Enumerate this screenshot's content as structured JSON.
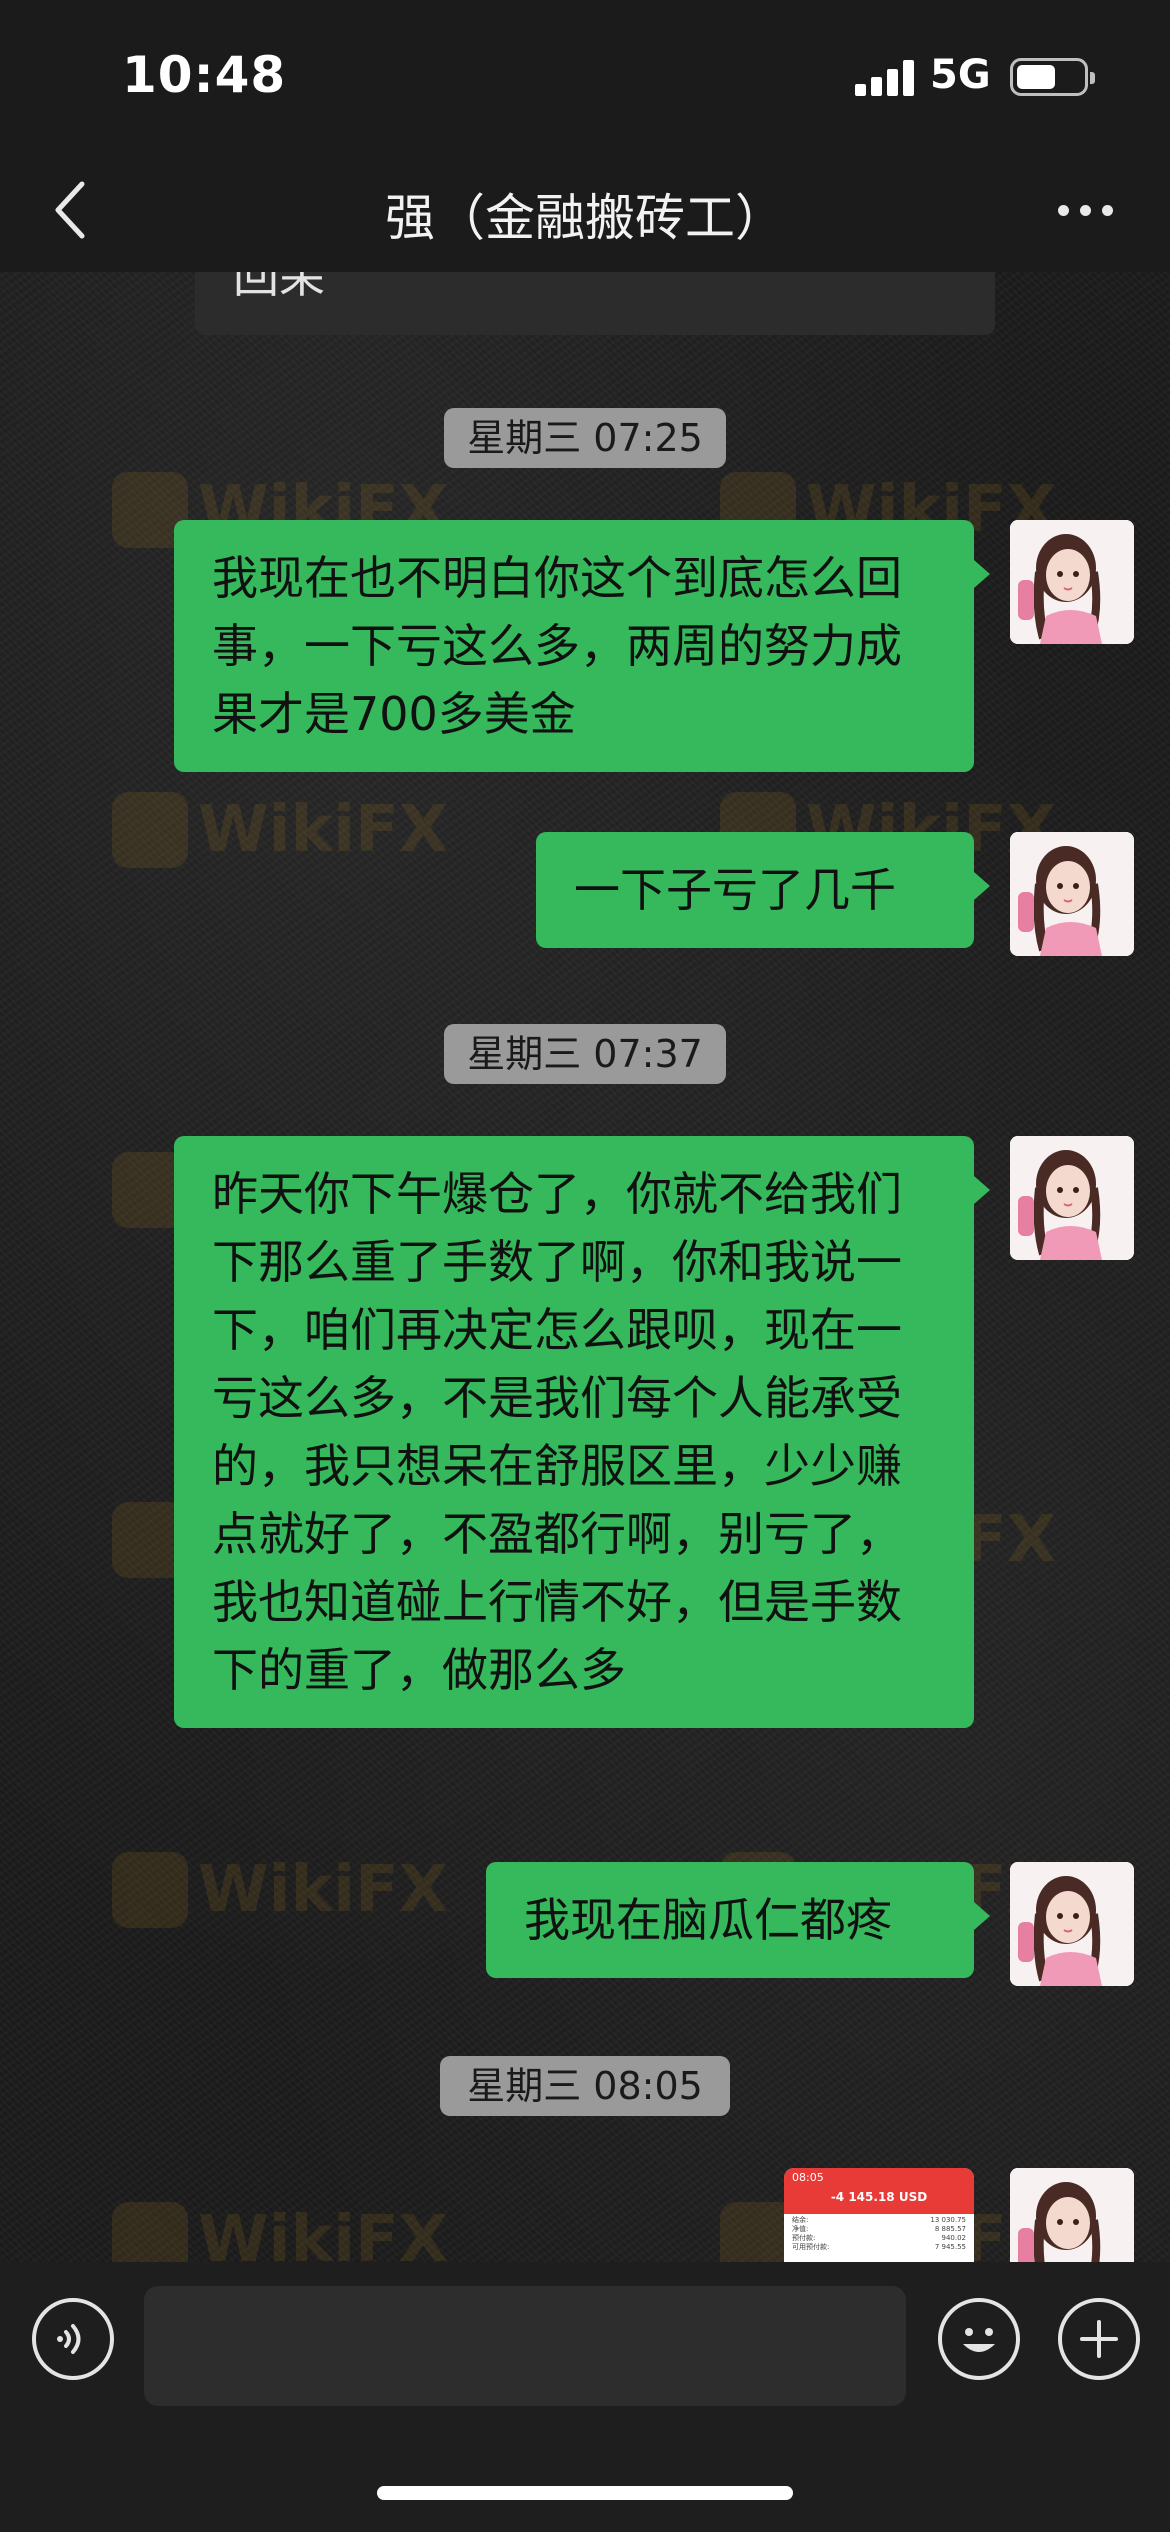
{
  "status_bar": {
    "time": "10:48",
    "network": "5G"
  },
  "header": {
    "title": "强（金融搬砖工）"
  },
  "previous_bubble": {
    "text": "回呆"
  },
  "watermark_text": "WikiFX",
  "messages": [
    {
      "type": "timestamp",
      "text": "星期三 07:25"
    },
    {
      "type": "text",
      "sender": "me",
      "text": "我现在也不明白你这个到底怎么回事，一下亏这么多，两周的努力成果才是700多美金"
    },
    {
      "type": "text",
      "sender": "me",
      "text": "一下子亏了几千"
    },
    {
      "type": "timestamp",
      "text": "星期三 07:37"
    },
    {
      "type": "text",
      "sender": "me",
      "text": "昨天你下午爆仓了，你就不给我们下那么重了手数了啊，你和我说一下，咱们再决定怎么跟呗，现在一亏这么多，不是我们每个人能承受的，我只想呆在舒服区里，少少赚点就好了，不盈都行啊，别亏了，我也知道碰上行情不好，但是手数下的重了，做那么多"
    },
    {
      "type": "text",
      "sender": "me",
      "text": "我现在脑瓜仁都疼"
    },
    {
      "type": "timestamp",
      "text": "星期三 08:05"
    },
    {
      "type": "image",
      "sender": "me"
    }
  ],
  "image_message": {
    "time": "08:05",
    "amount": "-4 145.18 USD",
    "rows": [
      {
        "label": "结余:",
        "value": "13 030.75"
      },
      {
        "label": "净值:",
        "value": "8 885.57"
      },
      {
        "label": "预付款:",
        "value": "940.02"
      },
      {
        "label": "可用预付款:",
        "value": "7 945.55"
      }
    ]
  },
  "colors": {
    "bubble_green": "#35b95c",
    "timestamp_bg": "#9a9a9a",
    "header_bg": "#1b1b1b",
    "loss_red": "#e83a37"
  }
}
